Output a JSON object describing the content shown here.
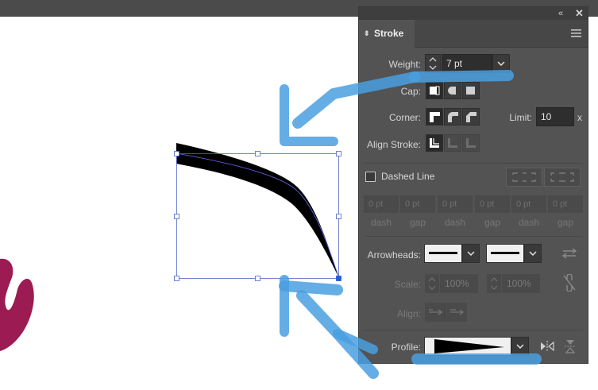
{
  "panel": {
    "collapse_icon": "double-chevron-left-icon",
    "close_icon": "close-icon",
    "tab_title": "Stroke",
    "tab_arrows": "◆",
    "weight": {
      "label": "Weight:",
      "value": "7 pt"
    },
    "cap": {
      "label": "Cap:",
      "selected": "butt"
    },
    "corner": {
      "label": "Corner:",
      "selected": "miter",
      "limit_label": "Limit:",
      "limit_value": "10",
      "limit_unit": "x"
    },
    "align_stroke": {
      "label": "Align Stroke:",
      "selected": "center"
    },
    "dashed_line": {
      "label": "Dashed Line",
      "checked": false
    },
    "dash_gap": [
      {
        "value": "0 pt",
        "label": "dash"
      },
      {
        "value": "0 pt",
        "label": "gap"
      },
      {
        "value": "0 pt",
        "label": "dash"
      },
      {
        "value": "0 pt",
        "label": "gap"
      },
      {
        "value": "0 pt",
        "label": "dash"
      },
      {
        "value": "0 pt",
        "label": "gap"
      }
    ],
    "arrowheads": {
      "label": "Arrowheads:"
    },
    "scale": {
      "label": "Scale:",
      "start": "100%",
      "end": "100%"
    },
    "align": {
      "label": "Align:"
    },
    "profile": {
      "label": "Profile:"
    }
  },
  "colors": {
    "panel_bg": "#535353",
    "annotation_blue": "#4a9fe0",
    "stroke_path": "#000000",
    "shape_crimson": "#9b1b52"
  }
}
